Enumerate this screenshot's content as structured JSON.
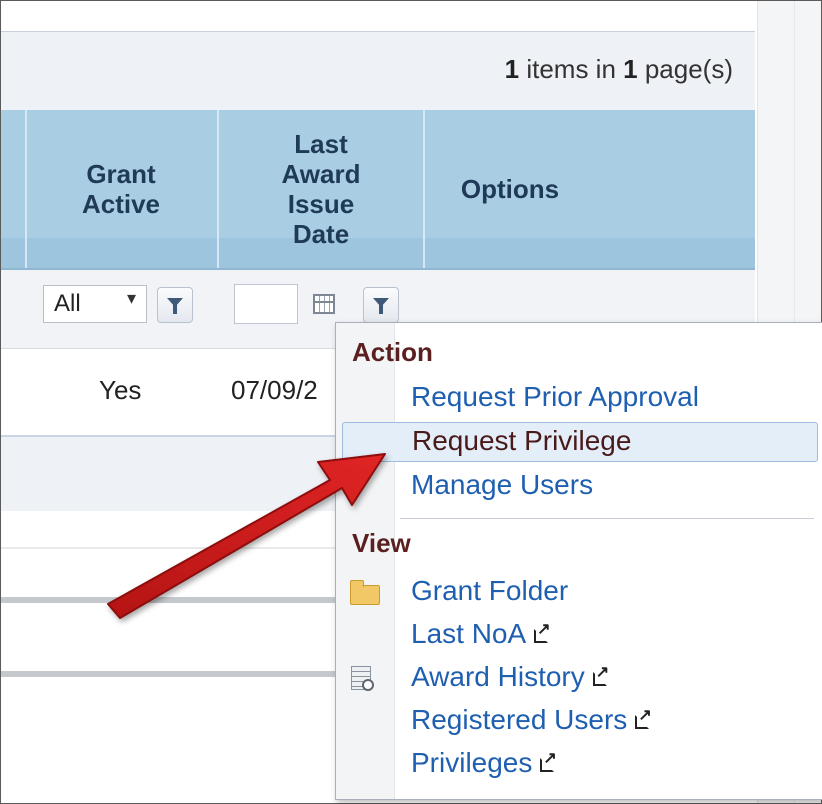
{
  "pager": {
    "count": "1",
    "text_a": " items in ",
    "pages": "1",
    "text_b": " page(s)"
  },
  "columns": {
    "grant_active": "Grant Active",
    "last_award_issue_date": "Last Award Issue Date",
    "options": "Options"
  },
  "filters": {
    "grant_active_value": "All"
  },
  "row": {
    "grant_active": "Yes",
    "last_award_issue_date": "07/09/2"
  },
  "context_menu": {
    "action_header": "Action",
    "action_items": [
      "Request Prior Approval",
      "Request Privilege",
      "Manage Users"
    ],
    "view_header": "View",
    "view_items": [
      "Grant Folder",
      "Last NoA",
      "Award History",
      "Registered Users",
      "Privileges"
    ],
    "highlighted_item": "Request Privilege"
  },
  "colors": {
    "header_bg": "#a9cde3",
    "link": "#1f5fb0",
    "annotation_arrow": "#d01c1c"
  },
  "icons": [
    "filter-icon",
    "calendar-icon",
    "dropdown-caret-icon",
    "folder-icon",
    "history-icon",
    "external-link-icon"
  ]
}
